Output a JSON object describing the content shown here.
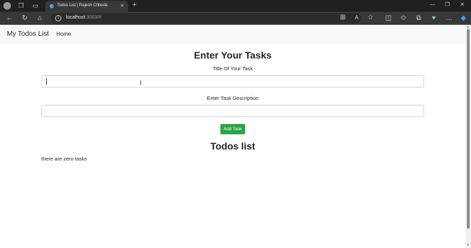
{
  "browser": {
    "tab_title": "Todos List | Rajesh Chheda",
    "url_host": "localhost",
    "url_rest": ":3003/#",
    "icons": [
      "profile-icon",
      "workspaces-icon",
      "tab-actions-icon",
      "new-tab-icon",
      "back-icon",
      "refresh-icon",
      "home-icon",
      "info-icon",
      "minimize-icon",
      "maximize-icon",
      "close-icon",
      "app-available-icon",
      "read-aloud-icon",
      "favorite-icon",
      "split-screen-icon",
      "favorites-icon",
      "collections-icon",
      "browser-essentials-icon",
      "more-icon",
      "copilot-icon"
    ]
  },
  "navbar": {
    "brand": "My Todos List",
    "home": "Home"
  },
  "form": {
    "heading": "Enter Your Tasks",
    "title_label": "Title Of Your Task",
    "title_value": "",
    "desc_label": "Enter Task Description",
    "desc_value": "",
    "add_button": "Add Task"
  },
  "list": {
    "heading": "Todos list",
    "empty_text": "there are zero tasks"
  },
  "colors": {
    "primary_button": "#28a745",
    "navbar_bg": "#f8f9fa"
  }
}
